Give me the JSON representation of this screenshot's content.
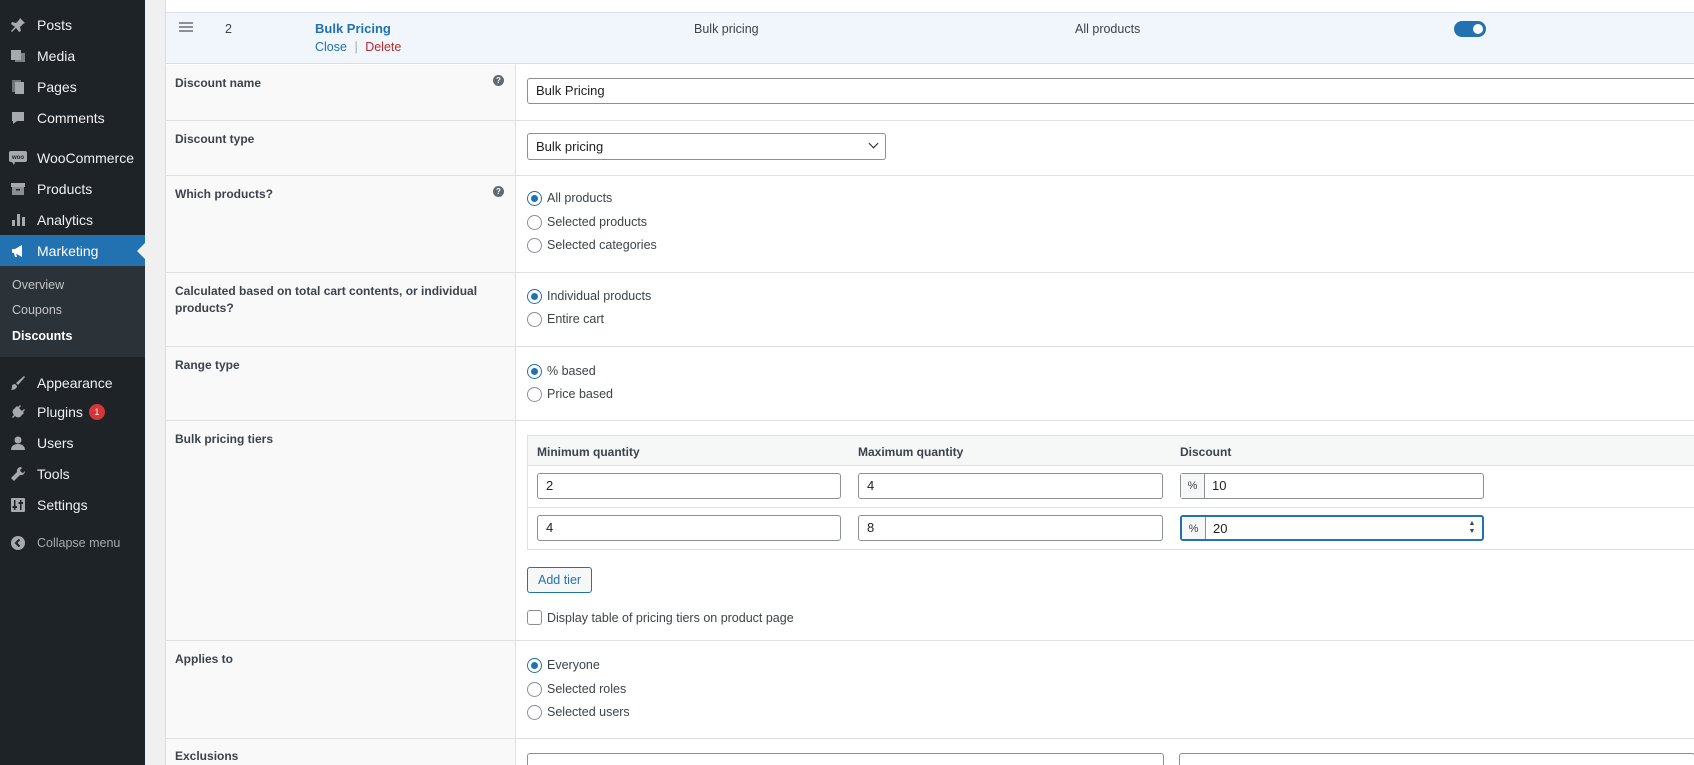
{
  "sidebar": {
    "items": [
      {
        "label": "Posts",
        "icon": "pin-icon"
      },
      {
        "label": "Media",
        "icon": "media-icon"
      },
      {
        "label": "Pages",
        "icon": "pages-icon"
      },
      {
        "label": "Comments",
        "icon": "comment-icon"
      },
      {
        "label": "WooCommerce",
        "icon": "woo-icon"
      },
      {
        "label": "Products",
        "icon": "archive-icon"
      },
      {
        "label": "Analytics",
        "icon": "bar-chart-icon"
      },
      {
        "label": "Marketing",
        "icon": "megaphone-icon"
      },
      {
        "label": "Appearance",
        "icon": "brush-icon"
      },
      {
        "label": "Plugins",
        "icon": "plug-icon",
        "badge": "1"
      },
      {
        "label": "Users",
        "icon": "user-icon"
      },
      {
        "label": "Tools",
        "icon": "wrench-icon"
      },
      {
        "label": "Settings",
        "icon": "sliders-icon"
      }
    ],
    "submenu": [
      "Overview",
      "Coupons",
      "Discounts"
    ],
    "collapse_label": "Collapse menu",
    "accent_color": "#2271b1"
  },
  "discount_header": {
    "number": "2",
    "title": "Bulk Pricing",
    "close_label": "Close",
    "separator": "|",
    "delete_label": "Delete",
    "type": "Bulk pricing",
    "products": "All products",
    "enabled": true
  },
  "fields": {
    "discount_name": {
      "label": "Discount name",
      "value": "Bulk Pricing",
      "help": "?"
    },
    "discount_type": {
      "label": "Discount type",
      "value": "Bulk pricing"
    },
    "which_products": {
      "label": "Which products?",
      "help": "?",
      "options": [
        "All products",
        "Selected products",
        "Selected categories"
      ],
      "selected": "All products"
    },
    "calculated_based": {
      "label": "Calculated based on total cart contents, or individual products?",
      "options": [
        "Individual products",
        "Entire cart"
      ],
      "selected": "Individual products"
    },
    "range_type": {
      "label": "Range type",
      "options": [
        "% based",
        "Price based"
      ],
      "selected": "% based"
    },
    "bulk_tiers": {
      "label": "Bulk pricing tiers",
      "columns": [
        "Minimum quantity",
        "Maximum quantity",
        "Discount"
      ],
      "rows": [
        {
          "min": "2",
          "max": "4",
          "prefix": "%",
          "discount": "10"
        },
        {
          "min": "4",
          "max": "8",
          "prefix": "%",
          "discount": "20"
        }
      ],
      "add_tier_label": "Add tier",
      "display_table_label": "Display table of pricing tiers on product page"
    },
    "applies_to": {
      "label": "Applies to",
      "options": [
        "Everyone",
        "Selected roles",
        "Selected users"
      ],
      "selected": "Everyone"
    },
    "exclusions": {
      "label": "Exclusions"
    }
  }
}
